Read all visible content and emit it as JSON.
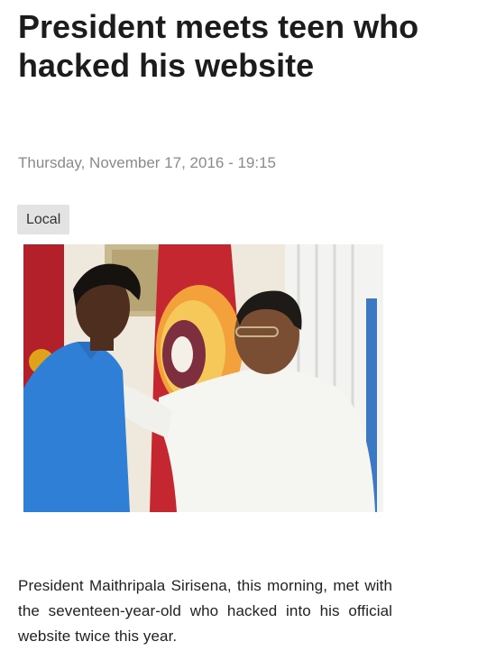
{
  "article": {
    "headline": "President meets teen who hacked his website",
    "date": "Thursday, November 17, 2016 - 19:15",
    "category": "Local",
    "body": "President Maithripala Sirisena, this morning, met with the seventeen-year-old who hacked into his official website twice this year."
  },
  "photo": {
    "subject": "president-and-teen-photo"
  }
}
